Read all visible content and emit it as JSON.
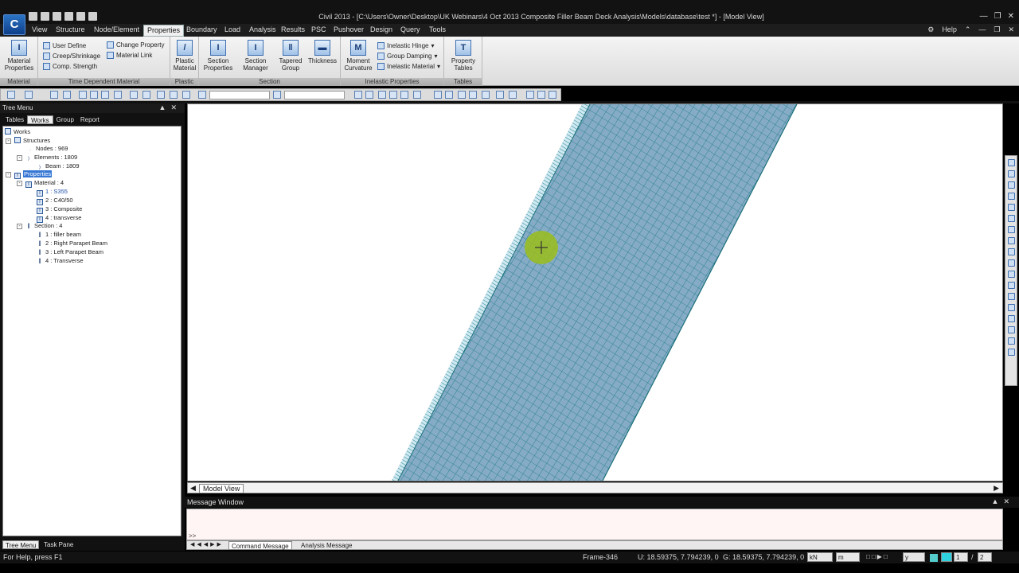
{
  "app": {
    "window_title": "Civil 2013 - [C:\\Users\\Owner\\Desktop\\UK Webinars\\4 Oct 2013 Composite Filler Beam Deck Analysis\\Models\\database\\test *] - [Model View]",
    "logo_text": "C"
  },
  "menubar": {
    "items": [
      "View",
      "Structure",
      "Node/Element",
      "Properties",
      "Boundary",
      "Load",
      "Analysis",
      "Results",
      "PSC",
      "Pushover",
      "Design",
      "Query",
      "Tools"
    ],
    "active": "Properties",
    "help": "Help"
  },
  "ribbon": {
    "groups": {
      "material": "Material",
      "time_dependent": "Time Dependent Material",
      "plastic": "Plastic",
      "section": "Section",
      "inelastic": "Inelastic Properties",
      "tables": "Tables"
    },
    "buttons": {
      "material_properties_1": "Material",
      "material_properties_2": "Properties",
      "user_define": "User Define",
      "creep_shrinkage": "Creep/Shrinkage",
      "comp_strength": "Comp. Strength",
      "change_property": "Change Property",
      "material_link": "Material Link",
      "plastic_material_1": "Plastic",
      "plastic_material_2": "Material",
      "section_properties_1": "Section",
      "section_properties_2": "Properties",
      "section_manager_1": "Section",
      "section_manager_2": "Manager",
      "tapered_group_1": "Tapered",
      "tapered_group_2": "Group",
      "thickness": "Thickness",
      "moment_curvature_1": "Moment",
      "moment_curvature_2": "Curvature",
      "inelastic_hinge": "Inelastic Hinge",
      "group_damping": "Group Damping",
      "inelastic_material": "Inelastic Material",
      "property_tables_1": "Property",
      "property_tables_2": "Tables"
    }
  },
  "tree": {
    "title": "Tree Menu",
    "tabs": [
      "Tables",
      "Works",
      "Group",
      "Report"
    ],
    "active_tab": "Works",
    "nodes": {
      "works": "Works",
      "structures": "Structures",
      "nodes": "Nodes : 969",
      "elements": "Elements : 1809",
      "beam": "Beam : 1809",
      "properties": "Properties",
      "material": "Material : 4",
      "mat1": "1 : S355",
      "mat2": "2 : C40/50",
      "mat3": "3 : Composite",
      "mat4": "4 : transverse",
      "section": "Section : 4",
      "sec1": "1 : filler beam",
      "sec2": "2 : Right Parapet Beam",
      "sec3": "3 : Left Parapet Beam",
      "sec4": "4 : Transverse"
    },
    "bottom_tabs": [
      "Tree Menu",
      "Task Pane"
    ]
  },
  "view": {
    "tab_label": "Model View"
  },
  "message": {
    "title": "Message Window",
    "prompt": ">>",
    "tabs": [
      "Command Message",
      "Analysis Message"
    ]
  },
  "status": {
    "help": "For Help, press F1",
    "frame": "Frame-346",
    "u": "U: 18.59375, 7.794239, 0",
    "g": "G: 18.59375, 7.794239, 0",
    "force_unit": "kN",
    "length_unit": "m",
    "axis": "y",
    "page": "1",
    "pages": "2"
  },
  "colors": {
    "mesh_fill": "#7fa9c4",
    "mesh_line": "#1f7f8a",
    "cursor_highlight": "#9bbd1a"
  }
}
